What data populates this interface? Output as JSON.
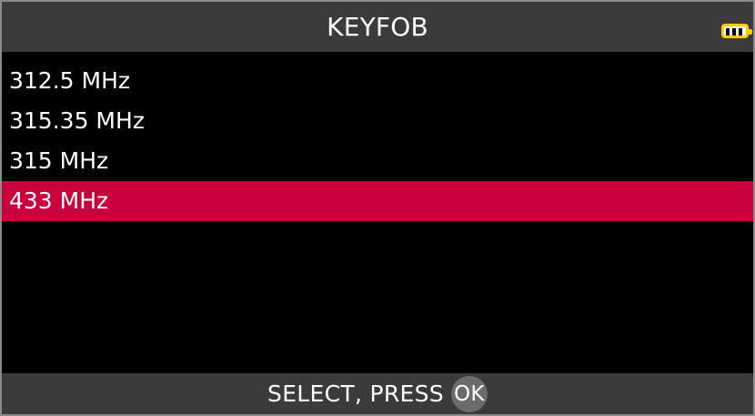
{
  "header": {
    "title": "KEYFOB",
    "battery_icon": "battery-full-icon",
    "battery_color": "#ffcc00"
  },
  "list": {
    "items": [
      {
        "label": "312.5 MHz"
      },
      {
        "label": "315.35 MHz"
      },
      {
        "label": "315 MHz"
      },
      {
        "label": "433 MHz"
      }
    ],
    "selected_index": 3,
    "selected_color": "#c8003c"
  },
  "footer": {
    "instruction": "SELECT, PRESS",
    "ok_label": "OK",
    "ok_icon": "ok-button-icon"
  }
}
